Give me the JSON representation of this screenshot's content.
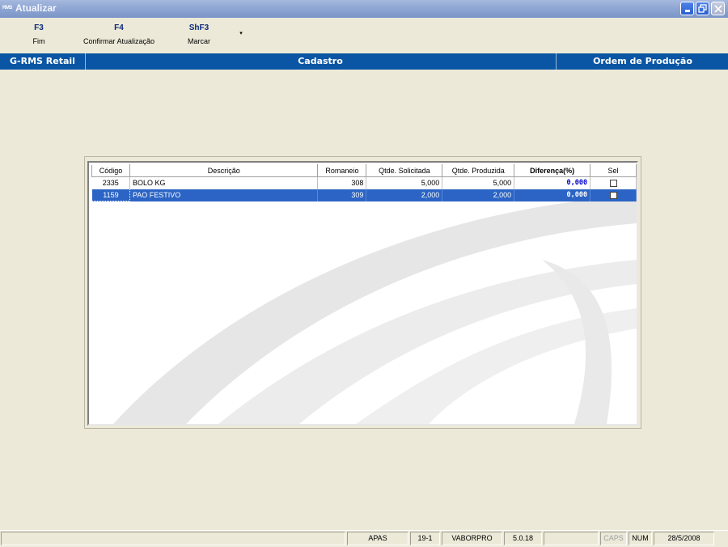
{
  "window": {
    "title": "Atualizar",
    "logo_text": "RMS"
  },
  "toolbar": {
    "buttons": [
      {
        "key": "F3",
        "label": "Fim"
      },
      {
        "key": "F4",
        "label": "Confirmar Atualização"
      },
      {
        "key": "ShF3",
        "label": "Marcar"
      }
    ],
    "more_glyph": "▾"
  },
  "header": {
    "left": "G-RMS Retail",
    "center": "Cadastro",
    "right": "Ordem de Produção"
  },
  "table": {
    "columns": [
      "Código",
      "Descrição",
      "Romaneio",
      "Qtde. Solicitada",
      "Qtde. Produzida",
      "Diferença(%)",
      "Sel"
    ],
    "rows": [
      {
        "codigo": "2335",
        "descricao": "BOLO KG",
        "romaneio": "308",
        "solicitada": "5,000",
        "produzida": "5,000",
        "diferenca": "0,000",
        "sel": false
      },
      {
        "codigo": "1159",
        "descricao": "PAO FESTIVO",
        "romaneio": "309",
        "solicitada": "2,000",
        "produzida": "2,000",
        "diferenca": "0,000",
        "sel": false
      }
    ],
    "selected_row": 1
  },
  "status": {
    "empty": "",
    "company": "APAS",
    "terminal": "19-1",
    "user": "VABORPRO",
    "version": "5.0.18",
    "caps": "CAPS",
    "num": "NUM",
    "date": "28/5/2008"
  },
  "colors": {
    "header_bar": "#0a56a4",
    "selection": "#2b64c4",
    "difference_text": "#0000cc"
  }
}
